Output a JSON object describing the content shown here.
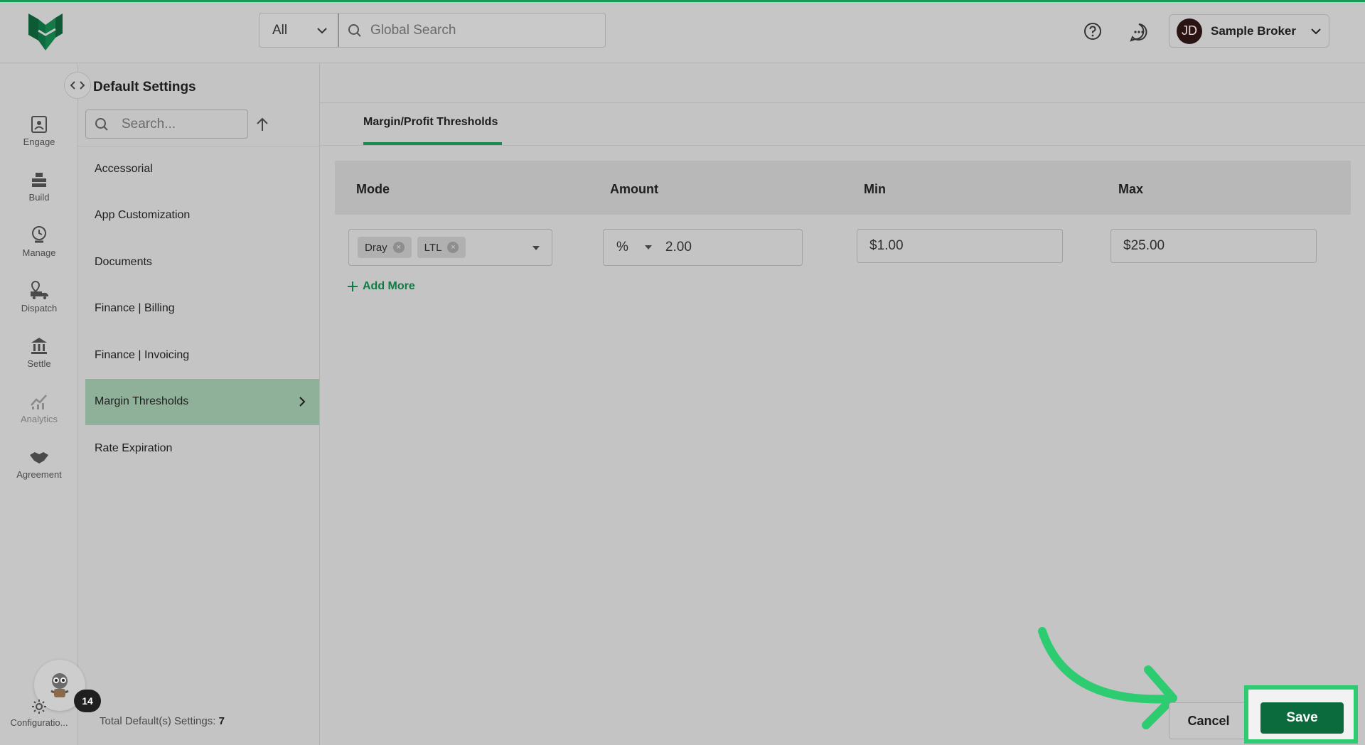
{
  "header": {
    "search_scope": "All",
    "search_placeholder": "Global Search",
    "user_initials": "JD",
    "user_name": "Sample Broker"
  },
  "nav": {
    "items": [
      {
        "label": "Engage",
        "icon": "engage-icon"
      },
      {
        "label": "Build",
        "icon": "build-icon"
      },
      {
        "label": "Manage",
        "icon": "manage-icon"
      },
      {
        "label": "Dispatch",
        "icon": "dispatch-icon"
      },
      {
        "label": "Settle",
        "icon": "settle-icon"
      },
      {
        "label": "Analytics",
        "icon": "analytics-icon"
      },
      {
        "label": "Agreement",
        "icon": "agreement-icon"
      }
    ],
    "badge_count": "14",
    "config_label": "Configuratio..."
  },
  "panel": {
    "title": "Default Settings",
    "search_placeholder": "Search...",
    "items": [
      "Accessorial",
      "App Customization",
      "Documents",
      "Finance | Billing",
      "Finance | Invoicing",
      "Margin Thresholds",
      "Rate Expiration"
    ],
    "active_item": "Margin Thresholds",
    "total_label": "Total Default(s) Settings:",
    "total_value": "7"
  },
  "main": {
    "tab_label": "Margin/Profit Thresholds",
    "columns": [
      "Mode",
      "Amount",
      "Min",
      "Max"
    ],
    "row": {
      "mode_chips": [
        "Dray",
        "LTL"
      ],
      "amount_unit": "%",
      "amount_value": "2.00",
      "min": "$1.00",
      "max": "$25.00"
    },
    "add_more": "Add More",
    "cancel": "Cancel",
    "save": "Save"
  },
  "colors": {
    "accent": "#0b6b3c",
    "active_item_bg": "#8fb099",
    "highlight_frame": "#2ecc71"
  }
}
